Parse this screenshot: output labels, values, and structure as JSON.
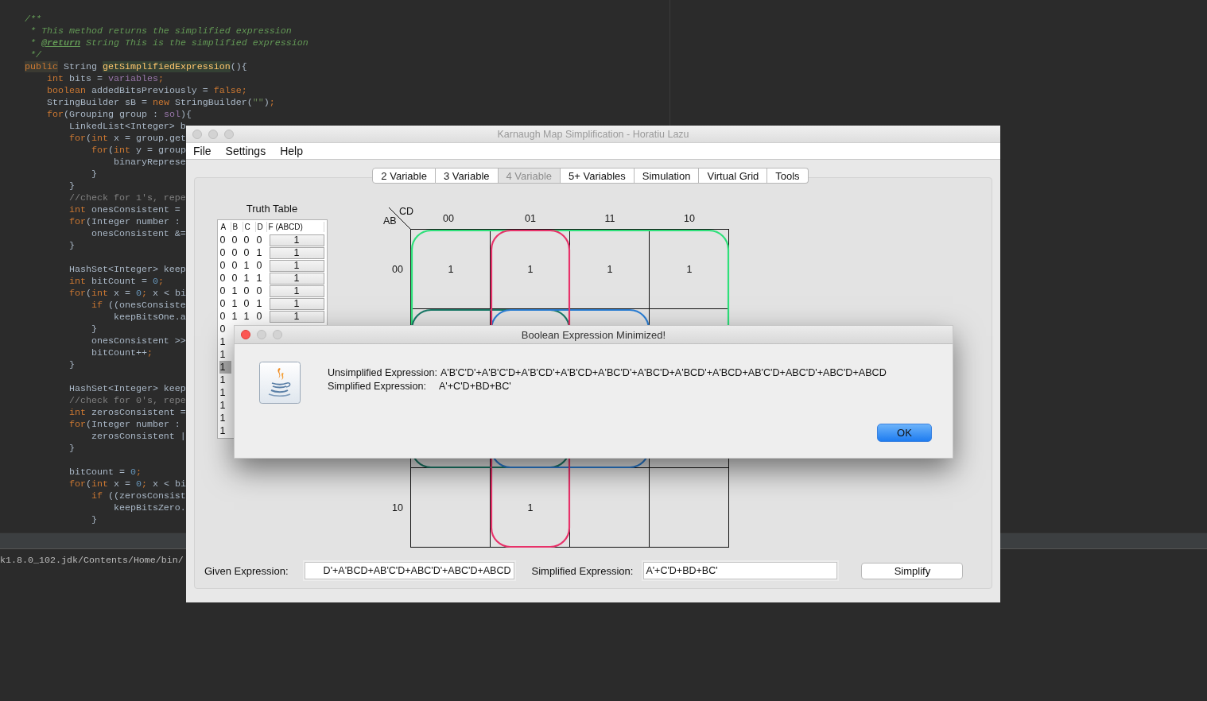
{
  "editor": {
    "blocks": [
      [
        [
          {
            "kind": "doc",
            "text": "/**"
          }
        ],
        [
          {
            "kind": "doc",
            "text": " * This method returns the simplified expression"
          }
        ],
        [
          {
            "kind": "doc",
            "text": " * "
          },
          {
            "kind": "doctag",
            "text": "@return"
          },
          {
            "kind": "doc",
            "text": " String This is the simplified expression"
          }
        ],
        [
          {
            "kind": "doc",
            "text": " */"
          }
        ],
        [
          {
            "kind": "mark",
            "text": "public"
          },
          {
            "kind": "plain",
            "text": " String "
          },
          {
            "kind": "method",
            "text": "getSimplifiedExpression"
          },
          {
            "kind": "plain",
            "text": "(){"
          }
        ],
        [
          {
            "kind": "keyword",
            "text": "    int"
          },
          {
            "kind": "plain",
            "text": " bits = "
          },
          {
            "kind": "field",
            "text": "variables"
          },
          {
            "kind": "keyword",
            "text": ";"
          }
        ],
        [
          {
            "kind": "keyword",
            "text": "    boolean"
          },
          {
            "kind": "plain",
            "text": " addedBitsPreviously = "
          },
          {
            "kind": "keyword",
            "text": "false;"
          }
        ],
        [
          {
            "kind": "plain",
            "text": "    StringBuilder sB = "
          },
          {
            "kind": "keyword",
            "text": "new"
          },
          {
            "kind": "plain",
            "text": " StringBuilder("
          },
          {
            "kind": "string",
            "text": "\"\""
          },
          {
            "kind": "plain",
            "text": ")"
          },
          {
            "kind": "keyword",
            "text": ";"
          }
        ],
        [
          {
            "kind": "keyword",
            "text": "    for"
          },
          {
            "kind": "plain",
            "text": "(Grouping group : "
          },
          {
            "kind": "field",
            "text": "sol"
          },
          {
            "kind": "plain",
            "text": "){"
          }
        ],
        [
          {
            "kind": "plain",
            "text": "        LinkedList<Integer> b"
          }
        ],
        [
          {
            "kind": "keyword",
            "text": "        for"
          },
          {
            "kind": "plain",
            "text": "("
          },
          {
            "kind": "keyword",
            "text": "int"
          },
          {
            "kind": "plain",
            "text": " x = group.get"
          }
        ],
        [
          {
            "kind": "keyword",
            "text": "            for"
          },
          {
            "kind": "plain",
            "text": "("
          },
          {
            "kind": "keyword",
            "text": "int"
          },
          {
            "kind": "plain",
            "text": " y = group"
          }
        ],
        [
          {
            "kind": "plain",
            "text": "                binaryReprese"
          }
        ],
        [
          {
            "kind": "plain",
            "text": "            }"
          }
        ],
        [
          {
            "kind": "plain",
            "text": "        }"
          }
        ],
        [
          {
            "kind": "comment",
            "text": "        //check for 1's, repe"
          }
        ],
        [
          {
            "kind": "keyword",
            "text": "        int"
          },
          {
            "kind": "plain",
            "text": " onesConsistent ="
          }
        ],
        [
          {
            "kind": "keyword",
            "text": "        for"
          },
          {
            "kind": "plain",
            "text": "(Integer number :"
          }
        ],
        [
          {
            "kind": "plain",
            "text": "            onesConsistent &="
          }
        ],
        [
          {
            "kind": "plain",
            "text": "        }"
          }
        ]
      ],
      [
        [
          {
            "kind": "plain",
            "text": "        HashSet<Integer> keep"
          }
        ],
        [
          {
            "kind": "keyword",
            "text": "        int"
          },
          {
            "kind": "plain",
            "text": " bitCount = "
          },
          {
            "kind": "number",
            "text": "0"
          },
          {
            "kind": "keyword",
            "text": ";"
          }
        ],
        [
          {
            "kind": "keyword",
            "text": "        for"
          },
          {
            "kind": "plain",
            "text": "("
          },
          {
            "kind": "keyword",
            "text": "int"
          },
          {
            "kind": "plain",
            "text": " x = "
          },
          {
            "kind": "number",
            "text": "0"
          },
          {
            "kind": "keyword",
            "text": ";"
          },
          {
            "kind": "plain",
            "text": " x < bi"
          }
        ],
        [
          {
            "kind": "keyword",
            "text": "            if"
          },
          {
            "kind": "plain",
            "text": " ((onesConsiste"
          }
        ],
        [
          {
            "kind": "plain",
            "text": "                keepBitsOne.a"
          }
        ],
        [
          {
            "kind": "plain",
            "text": "            }"
          }
        ],
        [
          {
            "kind": "plain",
            "text": "            onesConsistent >>"
          }
        ],
        [
          {
            "kind": "plain",
            "text": "            bitCount++"
          },
          {
            "kind": "keyword",
            "text": ";"
          }
        ],
        [
          {
            "kind": "plain",
            "text": "        }"
          }
        ]
      ],
      [
        [
          {
            "kind": "plain",
            "text": "        HashSet<Integer> keep"
          }
        ],
        [
          {
            "kind": "comment",
            "text": "        //check for 0's, repe"
          }
        ],
        [
          {
            "kind": "keyword",
            "text": "        int"
          },
          {
            "kind": "plain",
            "text": " zerosConsistent ="
          }
        ],
        [
          {
            "kind": "keyword",
            "text": "        for"
          },
          {
            "kind": "plain",
            "text": "(Integer number :"
          }
        ],
        [
          {
            "kind": "plain",
            "text": "            zerosConsistent |"
          }
        ],
        [
          {
            "kind": "plain",
            "text": "        }"
          }
        ]
      ],
      [
        [
          {
            "kind": "plain",
            "text": "        bitCount = "
          },
          {
            "kind": "number",
            "text": "0"
          },
          {
            "kind": "keyword",
            "text": ";"
          }
        ],
        [
          {
            "kind": "keyword",
            "text": "        for"
          },
          {
            "kind": "plain",
            "text": "("
          },
          {
            "kind": "keyword",
            "text": "int"
          },
          {
            "kind": "plain",
            "text": " x = "
          },
          {
            "kind": "number",
            "text": "0"
          },
          {
            "kind": "keyword",
            "text": ";"
          },
          {
            "kind": "plain",
            "text": " x < bi"
          }
        ],
        [
          {
            "kind": "keyword",
            "text": "            if"
          },
          {
            "kind": "plain",
            "text": " ((zerosConsist"
          }
        ],
        [
          {
            "kind": "plain",
            "text": "                keepBitsZero."
          }
        ],
        [
          {
            "kind": "plain",
            "text": "            }"
          }
        ]
      ]
    ]
  },
  "console": {
    "path": "k1.8.0_102.jdk/Contents/Home/bin/"
  },
  "app": {
    "title": "Karnaugh Map Simplification - Horatiu Lazu",
    "menu": [
      "File",
      "Settings",
      "Help"
    ],
    "tabs": [
      {
        "label": "2 Variable",
        "selected": false
      },
      {
        "label": "3 Variable",
        "selected": false
      },
      {
        "label": "4 Variable",
        "selected": true
      },
      {
        "label": "5+ Variables",
        "selected": false
      },
      {
        "label": "Simulation",
        "selected": false
      },
      {
        "label": "Virtual Grid",
        "selected": false
      },
      {
        "label": "Tools",
        "selected": false
      }
    ],
    "truth_table": {
      "title": "Truth Table",
      "columns": [
        "A",
        "B",
        "C",
        "D",
        "F (ABCD)"
      ],
      "rows": [
        {
          "a": "0",
          "b": "0",
          "c": "0",
          "d": "0",
          "f": "1",
          "selected": false
        },
        {
          "a": "0",
          "b": "0",
          "c": "0",
          "d": "1",
          "f": "1",
          "selected": false
        },
        {
          "a": "0",
          "b": "0",
          "c": "1",
          "d": "0",
          "f": "1",
          "selected": false
        },
        {
          "a": "0",
          "b": "0",
          "c": "1",
          "d": "1",
          "f": "1",
          "selected": false
        },
        {
          "a": "0",
          "b": "1",
          "c": "0",
          "d": "0",
          "f": "1",
          "selected": false
        },
        {
          "a": "0",
          "b": "1",
          "c": "0",
          "d": "1",
          "f": "1",
          "selected": false
        },
        {
          "a": "0",
          "b": "1",
          "c": "1",
          "d": "0",
          "f": "1",
          "selected": false
        },
        {
          "a": "0",
          "selected": false
        },
        {
          "a": "1",
          "selected": false
        },
        {
          "a": "1",
          "selected": false
        },
        {
          "a": "1",
          "selected": true
        },
        {
          "a": "1",
          "selected": false
        },
        {
          "a": "1",
          "selected": false
        },
        {
          "a": "1",
          "selected": false
        },
        {
          "a": "1",
          "selected": false
        },
        {
          "a": "1",
          "selected": false
        }
      ]
    },
    "kmap": {
      "corner_top": "CD",
      "corner_left": "AB",
      "columns": [
        "00",
        "01",
        "11",
        "10"
      ],
      "rows": [
        {
          "label": "00",
          "cells": [
            "1",
            "1",
            "1",
            "1"
          ]
        },
        null,
        null,
        {
          "label": "10",
          "cells": [
            null,
            "1",
            null,
            null
          ]
        }
      ],
      "groups": [
        {
          "color": "#2ee07a"
        },
        {
          "color": "#1b7a68"
        },
        {
          "color": "#2b7fd6"
        },
        {
          "color": "#e8326a"
        }
      ]
    },
    "given": {
      "label": "Given Expression:",
      "value": "D'+A'BCD+AB'C'D+ABC'D'+ABC'D+ABCD"
    },
    "simplified": {
      "label": "Simplified Expression:",
      "value": "A'+C'D+BD+BC'"
    },
    "simplify_button": "Simplify"
  },
  "dialog": {
    "title": "Boolean Expression Minimized!",
    "lines": [
      {
        "label": "Unsimplified Expression:",
        "value": "A'B'C'D'+A'B'C'D+A'B'CD'+A'B'CD+A'BC'D'+A'BC'D+A'BCD'+A'BCD+AB'C'D+ABC'D'+ABC'D+ABCD"
      },
      {
        "label": "Simplified Expression:",
        "value": "A'+C'D+BD+BC'"
      }
    ],
    "button": "OK"
  }
}
